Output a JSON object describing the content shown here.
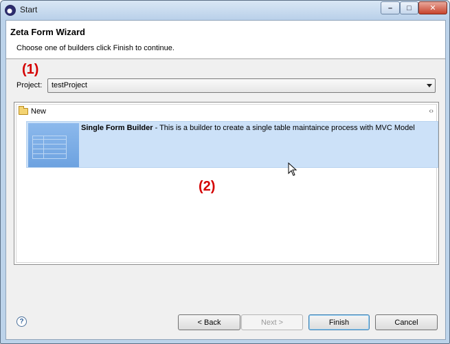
{
  "window": {
    "title": "Start"
  },
  "header": {
    "title": "Zeta Form Wizard",
    "description": "Choose one of builders click Finish to continue."
  },
  "annotations": {
    "one": "(1)",
    "two": "(2)"
  },
  "project": {
    "label": "Project:",
    "value": "testProject"
  },
  "builders": {
    "group_label": "New",
    "items": [
      {
        "name": "Single Form Builder",
        "description": " - This is a builder to create a single table maintaince process with MVC Model"
      }
    ]
  },
  "footer": {
    "back_label": "< Back",
    "next_label": "Next >",
    "finish_label": "Finish",
    "cancel_label": "Cancel"
  },
  "colors": {
    "selection": "#cce1f8",
    "annotation": "#d40000"
  }
}
